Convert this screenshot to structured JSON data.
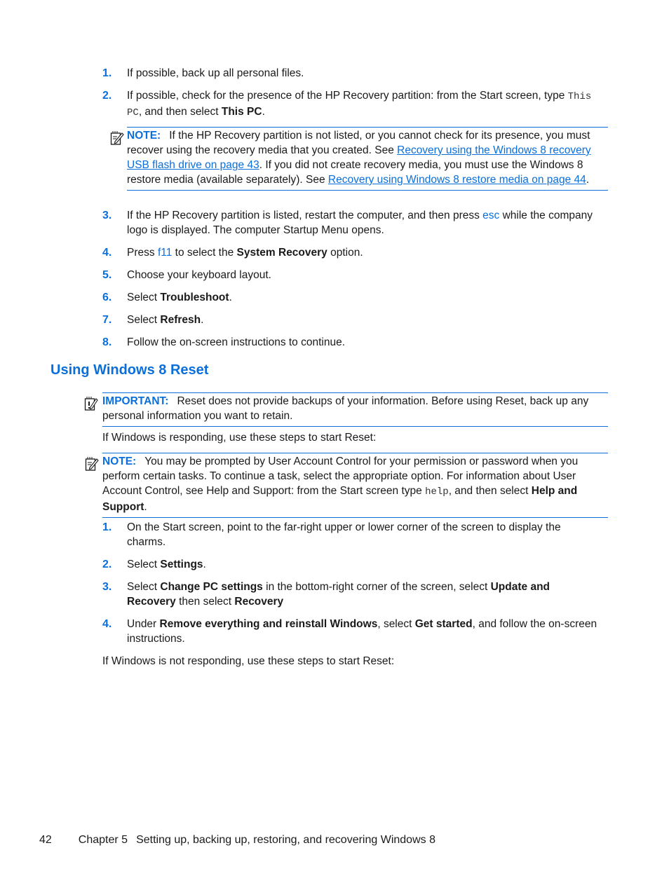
{
  "colors": {
    "accent": "#0a6fdb",
    "text": "#1a1a1a"
  },
  "section1": {
    "steps": [
      {
        "num": "1.",
        "parts": [
          {
            "t": "If possible, back up all personal files."
          }
        ]
      },
      {
        "num": "2.",
        "parts": [
          {
            "t": "If possible, check for the presence of the HP Recovery partition: from the Start screen, type "
          },
          {
            "t": "This PC",
            "style": "mono"
          },
          {
            "t": ", and then select "
          },
          {
            "t": "This PC",
            "style": "b"
          },
          {
            "t": "."
          }
        ]
      },
      {
        "num": "3.",
        "parts": [
          {
            "t": "If the HP Recovery partition is listed, restart the computer, and then press "
          },
          {
            "t": "esc",
            "style": "kbd"
          },
          {
            "t": " while the company logo is displayed. The computer Startup Menu opens."
          }
        ]
      },
      {
        "num": "4.",
        "parts": [
          {
            "t": "Press "
          },
          {
            "t": "f11",
            "style": "kbd"
          },
          {
            "t": " to select the "
          },
          {
            "t": "System Recovery",
            "style": "b"
          },
          {
            "t": " option."
          }
        ]
      },
      {
        "num": "5.",
        "parts": [
          {
            "t": "Choose your keyboard layout."
          }
        ]
      },
      {
        "num": "6.",
        "parts": [
          {
            "t": "Select "
          },
          {
            "t": "Troubleshoot",
            "style": "b"
          },
          {
            "t": "."
          }
        ]
      },
      {
        "num": "7.",
        "parts": [
          {
            "t": "Select "
          },
          {
            "t": "Refresh",
            "style": "b"
          },
          {
            "t": "."
          }
        ]
      },
      {
        "num": "8.",
        "parts": [
          {
            "t": "Follow the on-screen instructions to continue."
          }
        ]
      }
    ],
    "note": {
      "label": "NOTE:",
      "icon": "note-pencil-icon",
      "parts": [
        {
          "t": "If the HP Recovery partition is not listed, or you cannot check for its presence, you must recover using the recovery media that you created. See "
        },
        {
          "t": "Recovery using the Windows 8 recovery USB flash drive on page 43",
          "style": "link"
        },
        {
          "t": ". If you did not create recovery media, you must use the Windows 8 restore media (available separately). See "
        },
        {
          "t": "Recovery using Windows 8 restore media on page 44",
          "style": "link"
        },
        {
          "t": "."
        }
      ]
    }
  },
  "section2": {
    "heading": "Using Windows 8 Reset",
    "important": {
      "label": "IMPORTANT:",
      "icon": "important-pencil-icon",
      "text": "Reset does not provide backups of your information. Before using Reset, back up any personal information you want to retain."
    },
    "intro_responding": "If Windows is responding, use these steps to start Reset:",
    "note": {
      "label": "NOTE:",
      "icon": "note-pencil-icon",
      "parts": [
        {
          "t": "You may be prompted by User Account Control for your permission or password when you perform certain tasks. To continue a task, select the appropriate option. For information about User Account Control, see Help and Support: from the Start screen type "
        },
        {
          "t": "help",
          "style": "mono"
        },
        {
          "t": ", and then select "
        },
        {
          "t": "Help and Support",
          "style": "b"
        },
        {
          "t": "."
        }
      ]
    },
    "steps": [
      {
        "num": "1.",
        "parts": [
          {
            "t": "On the Start screen, point to the far-right upper or lower corner of the screen to display the charms."
          }
        ]
      },
      {
        "num": "2.",
        "parts": [
          {
            "t": "Select "
          },
          {
            "t": "Settings",
            "style": "b"
          },
          {
            "t": "."
          }
        ]
      },
      {
        "num": "3.",
        "parts": [
          {
            "t": "Select "
          },
          {
            "t": "Change PC settings",
            "style": "b"
          },
          {
            "t": " in the bottom-right corner of the screen, select "
          },
          {
            "t": "Update and Recovery",
            "style": "b"
          },
          {
            "t": " then select "
          },
          {
            "t": "Recovery",
            "style": "b"
          }
        ]
      },
      {
        "num": "4.",
        "parts": [
          {
            "t": "Under "
          },
          {
            "t": "Remove everything and reinstall Windows",
            "style": "b"
          },
          {
            "t": ", select "
          },
          {
            "t": "Get started",
            "style": "b"
          },
          {
            "t": ", and follow the on-screen instructions."
          }
        ]
      }
    ],
    "intro_not_responding": "If Windows is not responding, use these steps to start Reset:"
  },
  "footer": {
    "page_number": "42",
    "chapter": "Chapter 5",
    "chapter_title": "Setting up, backing up, restoring, and recovering Windows 8"
  }
}
